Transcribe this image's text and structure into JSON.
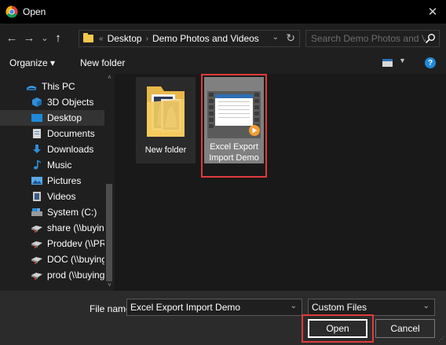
{
  "window": {
    "title": "Open",
    "close_glyph": "✕",
    "accent": "#e03a3a"
  },
  "nav": {
    "back": "←",
    "forward": "→",
    "history": "⌄",
    "up": "↑",
    "overflow": "«",
    "breadcrumb": [
      "Desktop",
      "Demo Photos and Videos"
    ],
    "breadcrumb_sep": "›",
    "address_dropdown": "⌄",
    "refresh": "↻",
    "search_placeholder": "Search Demo Photos and Vide..."
  },
  "toolbar": {
    "organize_label": "Organize ▾",
    "new_folder_label": "New folder",
    "view_dropdown": "▼",
    "help_label": "?"
  },
  "sidebar": {
    "scroll_up": "˄",
    "scroll_down": "˅",
    "items": [
      {
        "label": "This PC",
        "icon": "computer-icon",
        "selected": false
      },
      {
        "label": "3D Objects",
        "icon": "cube-icon",
        "selected": false
      },
      {
        "label": "Desktop",
        "icon": "desktop-icon",
        "selected": true
      },
      {
        "label": "Documents",
        "icon": "document-icon",
        "selected": false
      },
      {
        "label": "Downloads",
        "icon": "download-icon",
        "selected": false
      },
      {
        "label": "Music",
        "icon": "music-icon",
        "selected": false
      },
      {
        "label": "Pictures",
        "icon": "picture-icon",
        "selected": false
      },
      {
        "label": "Videos",
        "icon": "video-icon",
        "selected": false
      },
      {
        "label": "System (C:)",
        "icon": "drive-icon",
        "selected": false
      },
      {
        "label": "share (\\\\buying)",
        "icon": "network-drive-icon",
        "selected": false
      },
      {
        "label": "Proddev (\\\\PROD",
        "icon": "network-drive-icon",
        "selected": false
      },
      {
        "label": "DOC (\\\\buying) (",
        "icon": "network-drive-icon",
        "selected": false
      },
      {
        "label": "prod (\\\\buying) (",
        "icon": "network-drive-icon",
        "selected": false
      }
    ]
  },
  "files": [
    {
      "name": "New folder",
      "type": "folder",
      "selected": false
    },
    {
      "name": "Excel Export Import Demo",
      "type": "video",
      "selected": true
    }
  ],
  "footer": {
    "filename_label": "File name:",
    "filename_value": "Excel Export Import Demo",
    "filename_dropdown": "⌄",
    "filetype_value": "Custom Files",
    "filetype_dropdown": "⌄",
    "open_label": "Open",
    "cancel_label": "Cancel",
    "grip": "⋰"
  }
}
